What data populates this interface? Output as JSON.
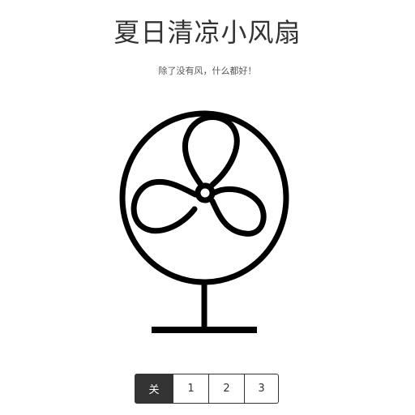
{
  "header": {
    "title": "夏日清凉小风扇",
    "subtitle": "除了没有风，什么都好！"
  },
  "fan": {
    "icon": "electric-fan-icon",
    "stroke_color": "#000000"
  },
  "controls": {
    "buttons": [
      {
        "label": "关",
        "active": true
      },
      {
        "label": "1",
        "active": false
      },
      {
        "label": "2",
        "active": false
      },
      {
        "label": "3",
        "active": false
      }
    ],
    "active_color": "#333333"
  }
}
